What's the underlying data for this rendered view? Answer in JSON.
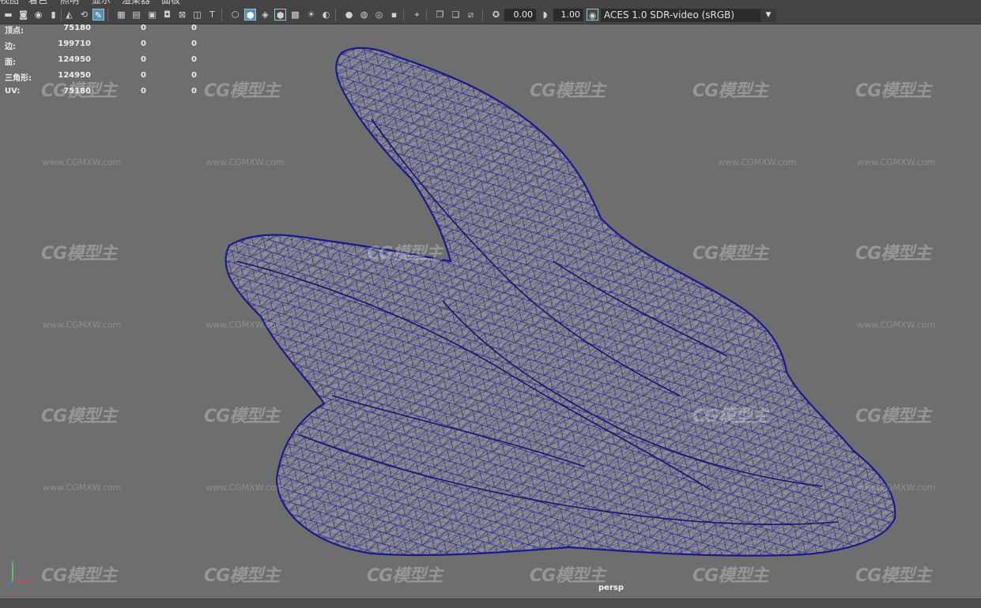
{
  "menu": [
    "视图",
    "着色",
    "照明",
    "显示",
    "渲染器",
    "面板"
  ],
  "toolbar": {
    "exposure_value": "0.00",
    "gamma_value": "1.00",
    "color_space": "ACES 1.0 SDR-video (sRGB)",
    "icons": [
      "camera-select-icon",
      "camera-attributes-icon",
      "bookmark-icon",
      "image-plane-icon",
      "film-gate-icon",
      "pencil-icon",
      "grid-icon",
      "film-gate-2-icon",
      "resolution-gate-icon",
      "gate-mask-icon",
      "field-chart-icon",
      "safe-action-icon",
      "safe-title-icon",
      "wireframe-icon",
      "smooth-shade-icon",
      "wireframe-on-shaded-icon",
      "textured-icon",
      "lighting-icon",
      "shadows-icon",
      "ambient-occlusion-icon",
      "motion-blur-icon",
      "anti-alias-icon",
      "depth-of-field-icon",
      "isolate-icon",
      "xray-icon",
      "xray-joints-icon",
      "backface-icon",
      "exposure-icon",
      "gamma-icon",
      "color-management-icon"
    ],
    "accent_color": "#5b8fb0"
  },
  "hud": {
    "rows": [
      {
        "label": "顶点:",
        "values": [
          "75180",
          "0",
          "0"
        ]
      },
      {
        "label": "边:",
        "values": [
          "199710",
          "0",
          "0"
        ]
      },
      {
        "label": "面:",
        "values": [
          "124950",
          "0",
          "0"
        ]
      },
      {
        "label": "三角形:",
        "values": [
          "124950",
          "0",
          "0"
        ]
      },
      {
        "label": "UV:",
        "values": [
          "75180",
          "0",
          "0"
        ]
      }
    ]
  },
  "viewport": {
    "camera_label": "persp",
    "background_color": "#6e6e6e",
    "wireframe_color": "#1a1a8c",
    "mesh_fill_color": "#8a8a8a"
  },
  "watermark": {
    "logo_text": "CG模型主",
    "url_text": "www.CGMXW.com"
  }
}
